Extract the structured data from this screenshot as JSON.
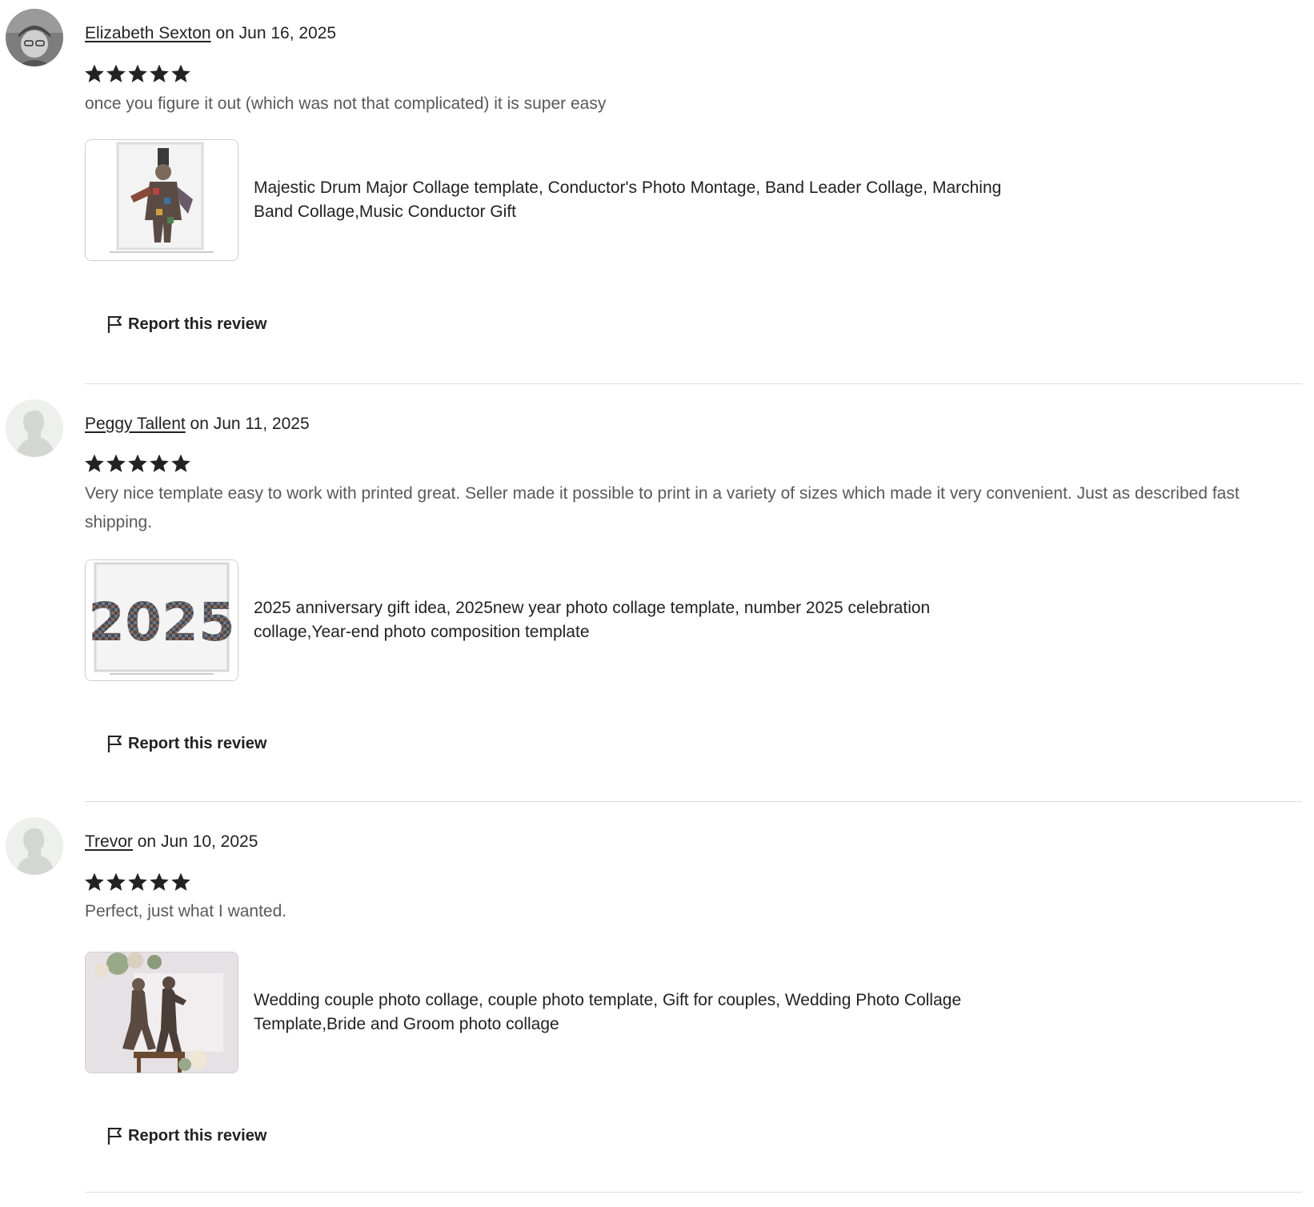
{
  "reviews": [
    {
      "reviewer_name": "Elizabeth Sexton",
      "date_text": "on Jun 16, 2025",
      "rating": 5,
      "text": "once you figure it out (which was not that complicated) it is super easy",
      "product_title": "Majestic Drum Major Collage template, Conductor's Photo Montage, Band Leader Collage, Marching Band Collage,Music Conductor Gift",
      "report_label": "Report this review"
    },
    {
      "reviewer_name": "Peggy Tallent",
      "date_text": "on Jun 11, 2025",
      "rating": 5,
      "text": "Very nice template easy to work with printed great. Seller made it possible to print in a variety of sizes which made it very convenient. Just as described fast shipping.",
      "product_title": "2025 anniversary gift idea, 2025new year photo collage template, number 2025 celebration collage,Year-end photo composition template",
      "thumbnail_text": "2025",
      "report_label": "Report this review"
    },
    {
      "reviewer_name": "Trevor",
      "date_text": "on Jun 10, 2025",
      "rating": 5,
      "text": "Perfect, just what I wanted.",
      "product_title": "Wedding couple photo collage, couple photo template, Gift for couples, Wedding Photo Collage Template,Bride and Groom photo collage",
      "report_label": "Report this review"
    }
  ],
  "icons": {
    "star": "star-icon",
    "flag": "flag-icon",
    "avatar_placeholder": "person-silhouette-icon"
  },
  "colors": {
    "text_primary": "#222222",
    "text_secondary": "#595959",
    "divider": "#dcdcdc",
    "star": "#222222"
  }
}
